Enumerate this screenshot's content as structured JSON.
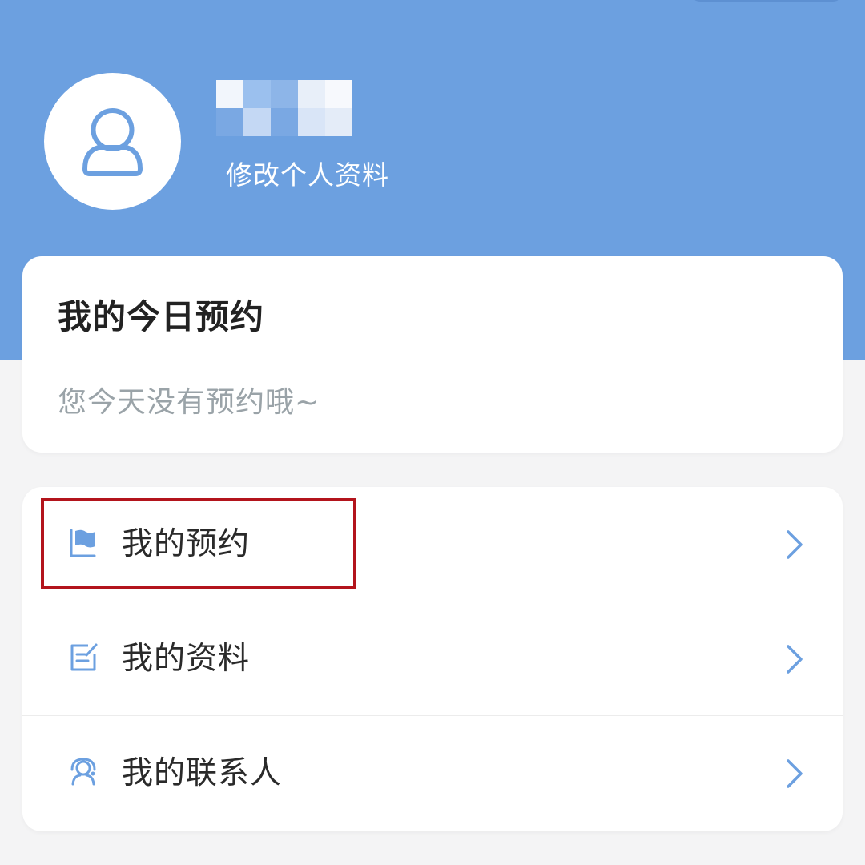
{
  "header": {
    "edit_profile_label": "修改个人资料",
    "accent_color": "#6ca0e0"
  },
  "today_card": {
    "title": "我的今日预约",
    "empty_text": "您今天没有预约哦~"
  },
  "menu": {
    "items": [
      {
        "label": "我的预约",
        "icon": "flag-icon",
        "highlighted": true
      },
      {
        "label": "我的资料",
        "icon": "edit-document-icon"
      },
      {
        "label": "我的联系人",
        "icon": "contact-person-icon"
      }
    ],
    "chevron_icon": "chevron-right-icon",
    "icon_color": "#6ca0e0",
    "highlight_color": "#b3141c"
  }
}
